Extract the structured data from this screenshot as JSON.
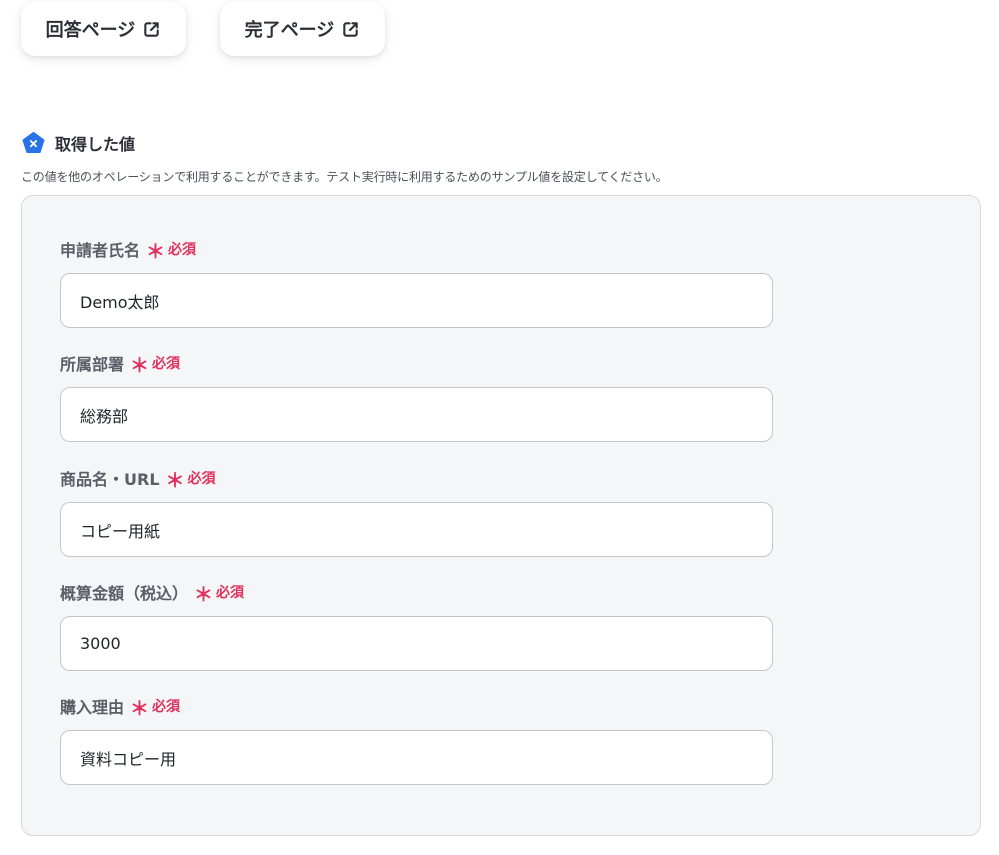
{
  "header": {
    "answer_page_label": "回答ページ",
    "complete_page_label": "完了ページ"
  },
  "section": {
    "title": "取得した値",
    "description": "この値を他のオペレーションで利用することができます。テスト実行時に利用するためのサンプル値を設定してください。"
  },
  "required_label": "必須",
  "required_mark": "＊",
  "fields": [
    {
      "label": "申請者氏名",
      "value": "Demo太郎"
    },
    {
      "label": "所属部署",
      "value": "総務部"
    },
    {
      "label": "商品名・URL",
      "value": "コピー用紙"
    },
    {
      "label": "概算金額（税込）",
      "value": "3000"
    },
    {
      "label": "購入理由",
      "value": "資料コピー用"
    }
  ],
  "colors": {
    "required": "#e0315d",
    "icon_blue": "#2a72e8"
  },
  "icons": [
    "external-link-icon",
    "variable-badge-icon"
  ]
}
